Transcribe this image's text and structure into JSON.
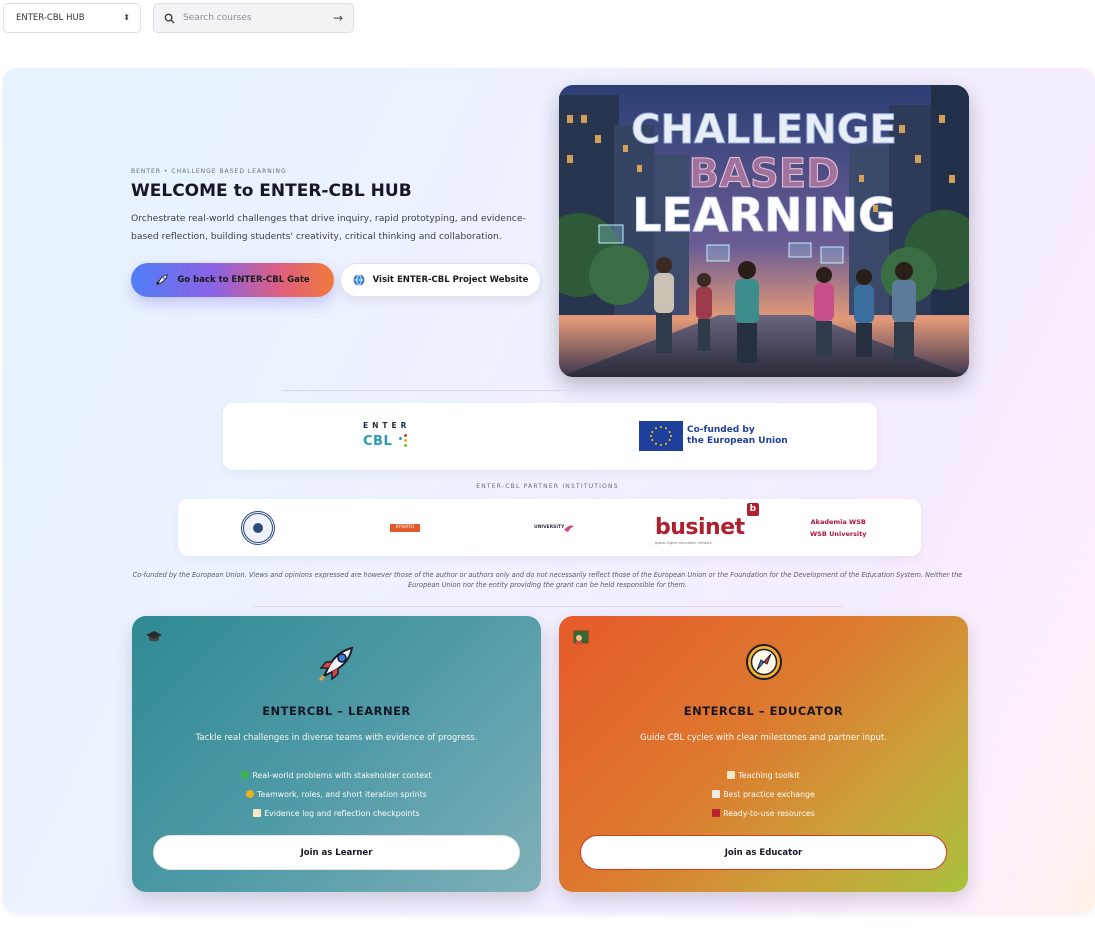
{
  "topbar": {
    "select_value": "ENTER-CBL HUB",
    "search_placeholder": "Search courses",
    "search_icon": "search-icon",
    "go_icon": "arrow-right-icon"
  },
  "hero": {
    "kicker": "BENTER • CHALLENGE BASED LEARNING",
    "title": "WELCOME to ENTER-CBL HUB",
    "lead": "Orchestrate real-world challenges that drive inquiry, rapid prototyping, and evidence-based reflection, building students' creativity, critical thinking and collaboration.",
    "primary_button": "Go back to ENTER-CBL Gate",
    "secondary_button": "Visit ENTER-CBL Project Website",
    "image_text": [
      "CHALLENGE",
      "BASED",
      "LEARNING"
    ]
  },
  "funding": {
    "enter_top": "ENTER",
    "enter_bottom": "CBL",
    "eu_line1": "Co-funded by",
    "eu_line2": "the European Union"
  },
  "partners": {
    "kicker": "ENTER-CBL PARTNER INSTITUTIONS",
    "porto": "P.PORTO",
    "university": "UNIVERSITY",
    "businet": "businet",
    "businet_badge": "b",
    "businet_sub": "global higher education network",
    "wsb_line1": "Akademia WSB",
    "wsb_line2": "WSB University"
  },
  "disclaimer": "Co-funded by the European Union. Views and opinions expressed are however those of the author or authors only and do not necessarily reflect those of the European Union or the Foundation for the Development of the Education System. Neither the European Union nor the entity providing the grant can be held responsible for them.",
  "cards": {
    "learner": {
      "title": "ENTERCBL – LEARNER",
      "desc": "Tackle real challenges in diverse teams with evidence of progress.",
      "items": [
        "Real-world problems with stakeholder context",
        "Teamwork, roles, and short iteration sprints",
        "Evidence log and reflection checkpoints"
      ],
      "button": "Join as Learner",
      "corner_icon": "graduation-cap-icon",
      "main_icon": "rocket-icon"
    },
    "educator": {
      "title": "ENTERCBL – EDUCATOR",
      "desc": "Guide CBL cycles with clear milestones and partner input.",
      "items": [
        "Teaching toolkit",
        "Best practice exchange",
        "Ready-to-use resources"
      ],
      "button": "Join as Educator",
      "corner_icon": "teacher-icon",
      "main_icon": "compass-icon"
    }
  }
}
